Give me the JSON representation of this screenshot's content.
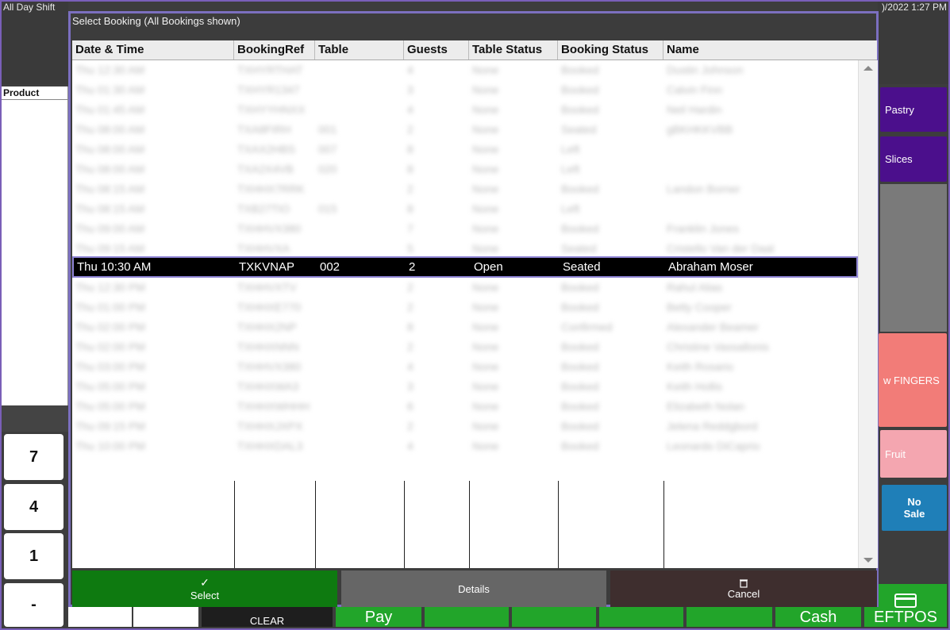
{
  "shift_label": "All Day Shift",
  "clock_text": ")/2022 1:27 PM",
  "product_panel": {
    "header": "Product"
  },
  "numpad": [
    "7",
    "4",
    "1",
    "-"
  ],
  "right_buttons": [
    {
      "label": "Pastry",
      "color": "#4b0f8c"
    },
    {
      "label": "Slices",
      "color": "#4b0f8c"
    },
    {
      "label": "w FINGERS",
      "color": "#f27c78"
    },
    {
      "label": "Fruit",
      "color": "#f4a6b0"
    },
    {
      "label": "No\nSale",
      "color": "#1f7fb8"
    }
  ],
  "bottom_bar": {
    "clear": "CLEAR",
    "pay": "Pay",
    "cash": "Cash",
    "eftpos": "EFTPOS"
  },
  "dialog": {
    "title": "Select Booking  (All Bookings shown)",
    "columns": [
      "Date & Time",
      "BookingRef",
      "Table",
      "Guests",
      "Table Status",
      "Booking Status",
      "Name"
    ],
    "rows": [
      [
        "Thu 12:30 AM",
        "TXHYRTHAT",
        "",
        "4",
        "None",
        "Booked",
        "Dustin Johnson"
      ],
      [
        "Thu 01:30 AM",
        "TXHYR1347",
        "",
        "3",
        "None",
        "Booked",
        "Calvin Finn"
      ],
      [
        "Thu 01:45 AM",
        "TXHYYHNXX",
        "",
        "4",
        "None",
        "Booked",
        "Neil Hardin"
      ],
      [
        "Thu 08:00 AM",
        "TXA8FIRH",
        "001",
        "2",
        "None",
        "Seated",
        "gBKHKKVBB"
      ],
      [
        "Thu 08:00 AM",
        "TXAX2HBS",
        "007",
        "8",
        "None",
        "Left",
        ""
      ],
      [
        "Thu 08:00 AM",
        "TXA2X4VB",
        "020",
        "8",
        "None",
        "Left",
        ""
      ],
      [
        "Thu 08:15 AM",
        "TXHHX7RRK",
        "",
        "2",
        "None",
        "Booked",
        "Landon Borner"
      ],
      [
        "Thu 08:15 AM",
        "TXB27TIO",
        "015",
        "8",
        "None",
        "Left",
        ""
      ],
      [
        "Thu 09:00 AM",
        "TXHHVX380",
        "",
        "7",
        "None",
        "Booked",
        "Franklin Jones"
      ],
      [
        "Thu 09:15 AM",
        "TXHHVXA",
        "",
        "5",
        "None",
        "Seated",
        "Cristello Van der Daal"
      ],
      [
        "Thu 10:30 AM",
        "TXKVNAP",
        "002",
        "2",
        "Open",
        "Seated",
        "Abraham Moser"
      ],
      [
        "Thu 12:30 PM",
        "TXHHVXTV",
        "",
        "2",
        "None",
        "Booked",
        "Rahul Alias"
      ],
      [
        "Thu 01:00 PM",
        "TXHHXE770",
        "",
        "2",
        "None",
        "Booked",
        "Betty Cooper"
      ],
      [
        "Thu 02:00 PM",
        "TXHHX2NP",
        "",
        "8",
        "None",
        "Confirmed",
        "Alexander Beamer"
      ],
      [
        "Thu 02:00 PM",
        "TXHHXNNN",
        "",
        "2",
        "None",
        "Booked",
        "Christine Vassallonis"
      ],
      [
        "Thu 03:00 PM",
        "TXHHVX380",
        "",
        "4",
        "None",
        "Booked",
        "Keith Rosario"
      ],
      [
        "Thu 05:00 PM",
        "TXHHXWA3",
        "",
        "3",
        "None",
        "Booked",
        "Keith Hollis"
      ],
      [
        "Thu 05:00 PM",
        "TXHHXWHHH",
        "",
        "6",
        "None",
        "Booked",
        "Elizabeth Nolan"
      ],
      [
        "Thu 09:15 PM",
        "TXHHXJXPX",
        "",
        "2",
        "None",
        "Booked",
        "Jelena Reddgbord"
      ],
      [
        "Thu 10:00 PM",
        "TXHHXDAL3",
        "",
        "4",
        "None",
        "Booked",
        "Leonardo DiCaprio"
      ]
    ],
    "selected_index": 10,
    "buttons": {
      "select": "Select",
      "details": "Details",
      "cancel": "Cancel"
    }
  }
}
